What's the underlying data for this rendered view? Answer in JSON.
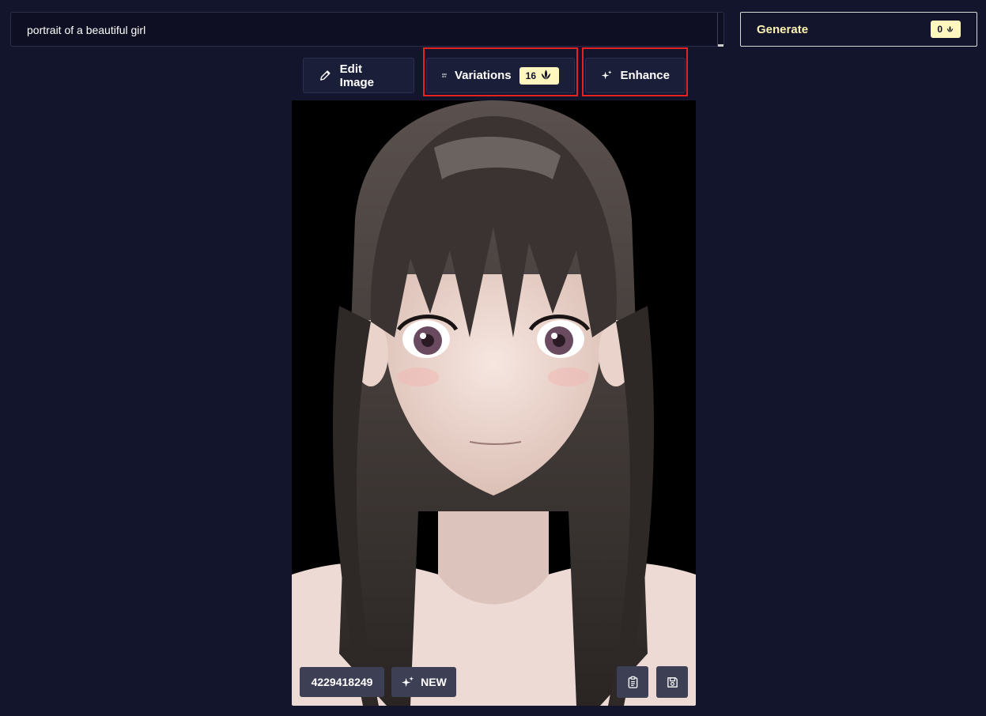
{
  "prompt": {
    "value": "portrait of a beautiful girl"
  },
  "generate": {
    "label": "Generate",
    "cost": "0",
    "cost_icon": "lotus-icon"
  },
  "toolbar": {
    "edit_label": "Edit Image",
    "edit_icon": "pencil-icon",
    "variations_label": "Variations",
    "variations_icon": "grid-plus-icon",
    "variations_cost": "16",
    "enhance_label": "Enhance",
    "enhance_icon": "sparkles-icon"
  },
  "image": {
    "seed": "4229418249",
    "new_label": "NEW",
    "new_icon": "sparkles-icon",
    "copy_icon": "clipboard-icon",
    "save_icon": "floppy-disk-icon"
  },
  "colors": {
    "background": "#13152d",
    "accent_badge": "#fff7bd",
    "generate_text": "#fff4b0",
    "highlight": "#e52222",
    "overlay_button": "#3d3f55"
  }
}
